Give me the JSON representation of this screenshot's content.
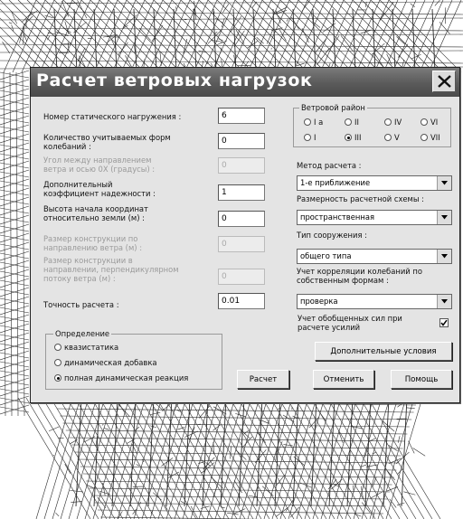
{
  "dialog": {
    "title": "Расчет ветровых нагрузок"
  },
  "left_fields": [
    {
      "label": "Номер статического нагружения :",
      "value": "6",
      "enabled": true
    },
    {
      "label": "Количество учитываемых форм\nколебаний :",
      "value": "0",
      "enabled": true
    },
    {
      "label": "Угол между направлением\nветра и осью 0X (градусы) :",
      "value": "0",
      "enabled": false
    },
    {
      "label": "Дополнительный\nкоэффициент надежности :",
      "value": "1",
      "enabled": true
    },
    {
      "label": "Высота начала координат\nотносительно земли (м) :",
      "value": "0",
      "enabled": true
    },
    {
      "label": "Размер конструкции по\nнаправлению ветра (м) :",
      "value": "0",
      "enabled": false
    },
    {
      "label": "Размер конструкции в\nнаправлении, перпендикулярном\nпотоку ветра (м) :",
      "value": "0",
      "enabled": false
    },
    {
      "label": "Точность расчета :",
      "value": "0.01",
      "enabled": true
    }
  ],
  "definition": {
    "title": "Определение",
    "options": [
      {
        "label": "квазистатика",
        "selected": false
      },
      {
        "label": "динамическая добавка",
        "selected": false
      },
      {
        "label": "полная динамическая реакция",
        "selected": true
      }
    ]
  },
  "wind_region": {
    "title": "Ветровой район",
    "row1": [
      {
        "label": "I a",
        "selected": false
      },
      {
        "label": "II",
        "selected": false
      },
      {
        "label": "IV",
        "selected": false
      },
      {
        "label": "VI",
        "selected": false
      }
    ],
    "row2": [
      {
        "label": "I",
        "selected": false
      },
      {
        "label": "III",
        "selected": true
      },
      {
        "label": "V",
        "selected": false
      },
      {
        "label": "VII",
        "selected": false
      }
    ]
  },
  "right_combos": [
    {
      "label": "Метод расчета :",
      "value": "1-е приближение"
    },
    {
      "label": "Размерность расчетной схемы :",
      "value": "пространственная"
    },
    {
      "label": "Тип сооружения :",
      "value": "общего типа"
    },
    {
      "label": "Учет корреляции колебаний по\nсобственным формам :",
      "value": "проверка"
    }
  ],
  "generalized": {
    "label": "Учет обобщенных сил при\nрасчете усилий",
    "checked": true
  },
  "buttons": {
    "extra": "Дополнительные условия",
    "calc": "Расчет",
    "cancel": "Отменить",
    "help": "Помощь"
  }
}
